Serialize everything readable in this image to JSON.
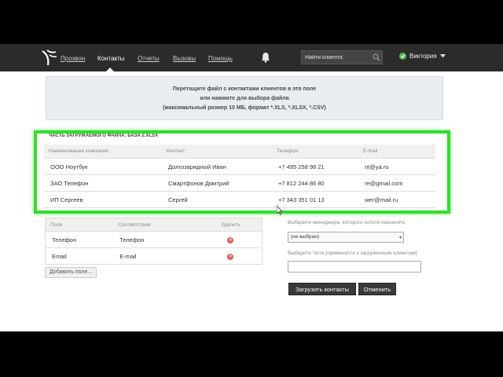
{
  "nav": {
    "items": [
      {
        "label": "Прозвон",
        "active": false
      },
      {
        "label": "Контакты",
        "active": true
      },
      {
        "label": "Отчеты",
        "active": false
      },
      {
        "label": "Вызовы",
        "active": false
      },
      {
        "label": "Помощь",
        "active": false
      }
    ],
    "search_placeholder": "Найти клиента",
    "user_name": "Виктория"
  },
  "icons": {
    "logo": "logo-icon",
    "notifications": "bell-icon",
    "search": "search-icon",
    "user_status": "check-circle-icon",
    "user_menu": "chevron-down-icon",
    "delete": "delete-icon"
  },
  "colors": {
    "topbar": "#2b2b2b",
    "highlight": "#33dd2c",
    "status_ok": "#5cb85c",
    "delete": "#e45a5a"
  },
  "dropzone": {
    "line1": "Перетащите файл с контактами клиентов в это поле",
    "line2": "или нажмите для выбора файла",
    "line3": "(максимальный размер 10 МБ, формат *.XLS, *.XLSX, *.CSV)"
  },
  "preview": {
    "title": "ЧАСТЬ ЗАГРУЖАЕМОГО ФАЙЛА: БАЗА 2.XLSX",
    "columns": [
      "Наименование компании",
      "Контакт",
      "Телефон",
      "E-mail"
    ],
    "rows": [
      [
        "ООО Ноутбук",
        "Долгозарядный Иван",
        "+7 495 258 98 21",
        "nt@ya.ru"
      ],
      [
        "ЗАО Телефон",
        "Смартфонов Дмитрий",
        "+7 812 244 86 80",
        "re@gmail.com"
      ],
      [
        "ИП Сергеев",
        "Сергей",
        "+7 343 351 01 13",
        "wer@mail.ru"
      ]
    ]
  },
  "mapping": {
    "columns": [
      "Поле",
      "Соответствие",
      "Удалить"
    ],
    "rows": [
      [
        "Телефон",
        "Телефон"
      ],
      [
        "Email",
        "E-mail"
      ]
    ],
    "add_label": "Добавить поле..."
  },
  "assign": {
    "manager_label": "Выберите менеджера, которого хотите назначить",
    "manager_value": "(не выбран)",
    "tag_label": "Выберите тег/и (применится к загруженным клиентам)",
    "tag_value": ""
  },
  "buttons": {
    "upload": "Загрузить контакты",
    "cancel": "Отменить"
  }
}
